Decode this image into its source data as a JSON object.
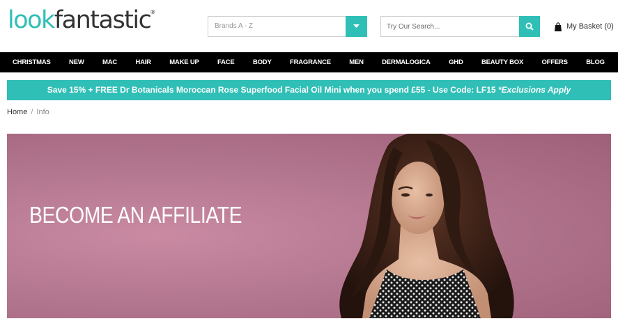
{
  "header": {
    "logo": {
      "part1": "look",
      "part2": "fantastic",
      "mark": "®"
    },
    "brands_select": {
      "label": "Brands A - Z",
      "icon": "chevron-down-icon"
    },
    "search": {
      "placeholder": "Try Our Search...",
      "icon": "search-icon"
    },
    "basket": {
      "label": "My Basket (0)",
      "icon": "shopping-bag-icon"
    }
  },
  "nav": {
    "items": [
      "CHRISTMAS",
      "NEW",
      "MAC",
      "HAIR",
      "MAKE UP",
      "FACE",
      "BODY",
      "FRAGRANCE",
      "MEN",
      "DERMALOGICA",
      "GHD",
      "BEAUTY BOX",
      "OFFERS",
      "BLOG"
    ]
  },
  "promo": {
    "text": "Save 15% + FREE Dr Botanicals Moroccan Rose Superfood Facial Oil Mini when you spend £55  - Use Code: LF15 ",
    "emphasis": "*Exclusions Apply"
  },
  "breadcrumb": {
    "home": "Home",
    "separator": "/",
    "current": "Info"
  },
  "hero": {
    "title": "BECOME AN AFFILIATE"
  },
  "colors": {
    "brand": "#2fbfb6",
    "nav_bg": "#000000",
    "hero_bg": "#b47790"
  }
}
